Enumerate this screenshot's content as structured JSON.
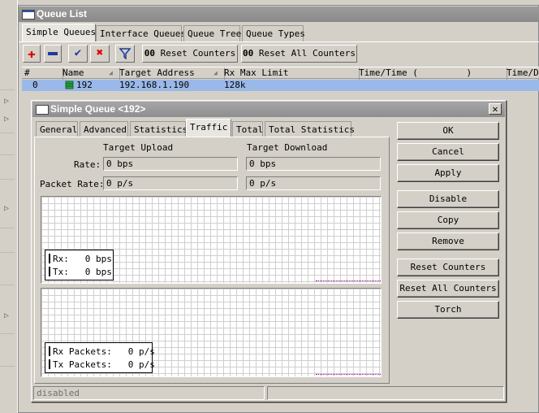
{
  "window": {
    "title": "Queue List"
  },
  "tabs": [
    "Simple Queues",
    "Interface Queues",
    "Queue Tree",
    "Queue Types"
  ],
  "toolbar": {
    "reset_counters": "Reset Counters",
    "reset_all_counters": "Reset All Counters",
    "counter_prefix": "00"
  },
  "table": {
    "headers": [
      "#",
      "Name",
      "Target Address",
      "Rx Max Limit",
      "Time/Time (         )",
      "Time/De"
    ],
    "row": {
      "num": "0",
      "name": "192",
      "target": "192.168.1.190",
      "rx_limit": "128k"
    }
  },
  "dialog": {
    "title": "Simple Queue <192>",
    "tabs": [
      "General",
      "Advanced",
      "Statistics",
      "Traffic",
      "Total",
      "Total Statistics"
    ],
    "active_tab": "Traffic",
    "col_upload": "Target Upload",
    "col_download": "Target Download",
    "rate_label": "Rate:",
    "packet_rate_label": "Packet Rate:",
    "rate_upload": "0 bps",
    "rate_download": "0 bps",
    "packet_upload": "0 p/s",
    "packet_download": "0 p/s",
    "legend1": {
      "rx": "Rx:   0 bps",
      "tx": "Tx:   0 bps"
    },
    "legend2": {
      "rx": "Rx Packets:   0 p/s",
      "tx": "Tx Packets:   0 p/s"
    },
    "buttons": [
      "OK",
      "Cancel",
      "Apply",
      "Disable",
      "Copy",
      "Remove",
      "Reset Counters",
      "Reset All Counters",
      "Torch"
    ],
    "status": "disabled"
  },
  "colors": {
    "rx": "#0000ff",
    "tx": "#ff0000",
    "selected_row": "#9ab8e8"
  }
}
